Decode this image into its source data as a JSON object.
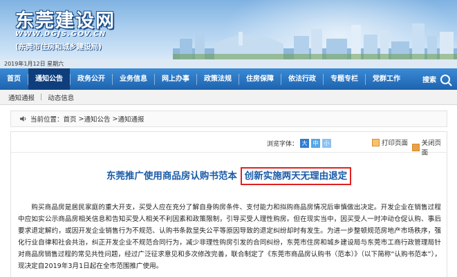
{
  "header": {
    "title": "东莞建设网",
    "url": "WWW.DGJS.GOV.CN",
    "subtitle": "(东莞市住房和城乡建设局)"
  },
  "date_bar": {
    "text": "2019年1月12日 星期六"
  },
  "nav": {
    "items": [
      {
        "label": "首页"
      },
      {
        "label": "通知公告"
      },
      {
        "label": "政务公开"
      },
      {
        "label": "业务信息"
      },
      {
        "label": "网上办事"
      },
      {
        "label": "政策法规"
      },
      {
        "label": "住房保障"
      },
      {
        "label": "依法行政"
      },
      {
        "label": "专题专栏"
      },
      {
        "label": "党群工作"
      }
    ],
    "search_label": "搜索"
  },
  "subnav": {
    "item1": "通知通报",
    "divider": "|",
    "item2": "动态信息"
  },
  "breadcrumb": {
    "prefix": "当前位置：",
    "home": "首页",
    "sep1": " >",
    "section": "通知公告",
    "sep2": " >",
    "current": "通知通报"
  },
  "toolbar": {
    "font_label": "浏览字体：",
    "font_big": "大",
    "font_mid": "中",
    "font_small": "小",
    "print_label": "打印页面",
    "close_label": "关闭页面"
  },
  "article": {
    "title_main": "东莞推广使用商品房认购书范本",
    "title_highlight": "创新实施两天无理由退定",
    "body": "购买商品房是居民家庭的重大开支，买受人应在充分了解自身购房条件、支付能力和拟购商品房情况后审慎做出决定。开发企业在销售过程中应如实公示商品房相关信息和告知买受人相关不利因素和政策限制，引导买受人理性购房。但在现实当中，因买受人一时冲动仓促认购、事后要求退定解约，或因开发企业销售行为不规范、认购书条款显失公平等原因导致的退定纠纷却时有发生。为进一步整顿规范房地产市场秩序，强化行业自律和社会共治，纠正开发企业不规范合同行为，减少非理性购房引发的合同纠纷，东莞市住房和城乡建设局与东莞市工商行政管理局针对商品房销售过程的常见共性问题，经过广泛征求意见和多次修改完善，联合制定了《东莞市商品房认购书（范本）》（以下简称“认购书范本”），现决定自2019年3月1日起在全市范围推广使用。"
  },
  "colors": {
    "nav_blue": "#1e63ae",
    "nav_active": "#0f3e7d",
    "title_blue": "#1a5ba8",
    "highlight_red": "#e02020"
  }
}
